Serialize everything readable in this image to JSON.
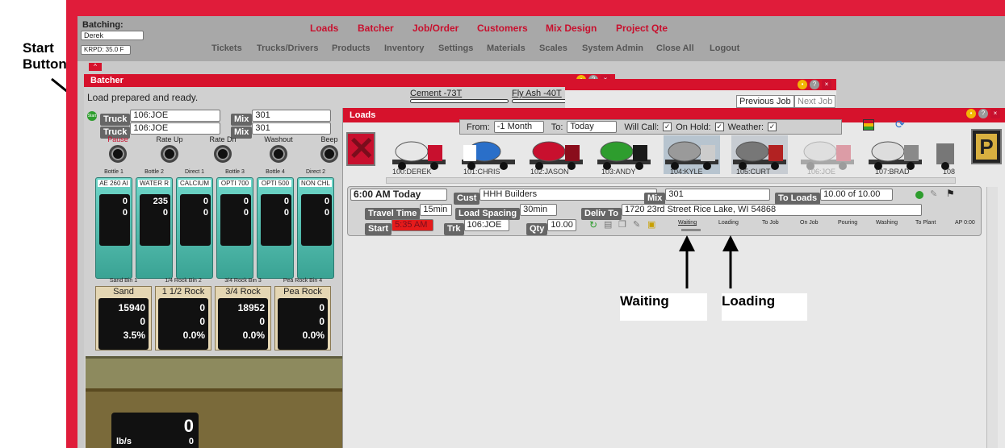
{
  "callouts": {
    "start_line1": "Start",
    "start_line2": "Button",
    "waiting": "Waiting",
    "loading": "Loading"
  },
  "header": {
    "batching_label": "Batching:",
    "batching_user": "Derek",
    "krpd": "KRPD: 35.0 F"
  },
  "menu_top": [
    "Loads",
    "Batcher",
    "Job/Order",
    "Customers",
    "Mix Design",
    "Project Qte"
  ],
  "menu_bottom": [
    "Tickets",
    "Trucks/Drivers",
    "Products",
    "Inventory",
    "Settings",
    "Materials",
    "Scales",
    "System Admin",
    "Close All",
    "Logout"
  ],
  "batcher": {
    "title": "Batcher",
    "status": "Load prepared and ready.",
    "cement": "Cement -73T",
    "flyash": "Fly Ash -40T",
    "truck_label": "Truck",
    "truck1": "106:JOE",
    "truck2": "106:JOE",
    "mix_label": "Mix",
    "mix1": "301",
    "mix2": "301",
    "start_label": "Start",
    "controls": [
      "Pause",
      "Rate Up",
      "Rate Dn",
      "Washout",
      "Beep"
    ],
    "silo_labels": [
      "Bottle 1",
      "Bottle 2",
      "Direct 1",
      "Bottle 3",
      "Bottle 4",
      "Direct 2"
    ],
    "silo_names": [
      "AE 260 AI",
      "WATER R",
      "CALCIUM",
      "OPTI 700",
      "OPTI 500",
      "NON CHL"
    ],
    "silo_top": [
      "0",
      "235",
      "0",
      "0",
      "0",
      "0"
    ],
    "silo_bottom": [
      "0",
      "0",
      "0",
      "0",
      "0",
      "0"
    ],
    "bin_labels": [
      "Sand Bin 1",
      "1/4 Rock Bin 2",
      "3/4 Rock Bin 3",
      "Pea Rock Bin 4"
    ],
    "bin_names": [
      "Sand",
      "1 1/2 Rock",
      "3/4 Rock",
      "Pea Rock"
    ],
    "bin_v1": [
      "15940",
      "0",
      "18952",
      "0"
    ],
    "bin_v2": [
      "0",
      "0",
      "0",
      "0"
    ],
    "bin_pct": [
      "3.5%",
      "0.0%",
      "0.0%",
      "0.0%"
    ],
    "scale_value": "0",
    "scale_unit": "lb/s",
    "scale_value2": "0"
  },
  "job": {
    "prev": "Previous Job",
    "next": "Next Job"
  },
  "loads": {
    "title": "Loads",
    "from_label": "From:",
    "from_value": "-1 Month",
    "to_label": "To:",
    "to_value": "Today",
    "willcall": "Will Call:",
    "onhold": "On Hold:",
    "weather": "Weather:",
    "trucks": [
      "100:DEREK",
      "101:CHRIS",
      "102:JASON",
      "103:ANDY",
      "104:KYLE",
      "105:CURT",
      "106:JOE",
      "107:BRAD",
      "108"
    ],
    "truck_colors": [
      "#e7e7e7",
      "#2a6fc9",
      "#c8102e",
      "#2e9d2e",
      "#9a9a9a",
      "#b22222",
      "#d0d0d0",
      "#8a8a8a",
      "#777"
    ],
    "time": "6:00 AM Today",
    "cust_label": "Cust",
    "cust": "HHH Builders",
    "mix_label": "Mix",
    "mix": "301",
    "toloads_label": "To Loads",
    "toloads": "10.00 of 10.00",
    "travel_label": "Travel Time",
    "travel": "15min",
    "spacing_label": "Load Spacing",
    "spacing": "30min",
    "deliv_label": "Deliv To",
    "deliv": "1720 23rd Street Rice Lake, WI 54868",
    "start_label": "Start",
    "start": "5:35 AM",
    "trk_label": "Trk",
    "trk": "106:JOE",
    "qty_label": "Qty",
    "qty": "10.00",
    "statuses": [
      "Waiting",
      "Loading",
      "To Job",
      "On Job",
      "Pouring",
      "Washing",
      "To Plant",
      "AP 0:00"
    ]
  }
}
